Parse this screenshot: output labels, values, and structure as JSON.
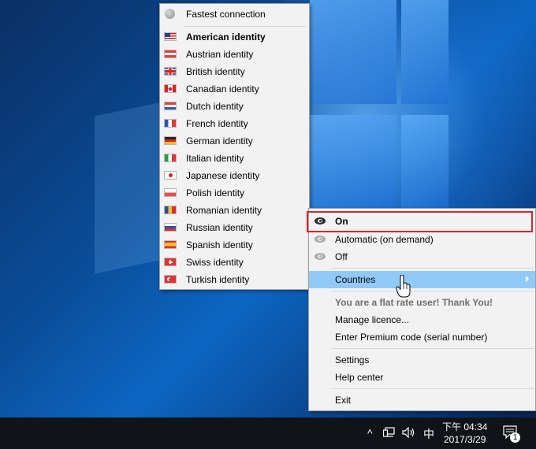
{
  "identity_menu": {
    "fastest": "Fastest connection",
    "items": [
      {
        "label": "American identity",
        "flag": "us-flag"
      },
      {
        "label": "Austrian identity",
        "flag": "at-flag"
      },
      {
        "label": "British identity",
        "flag": "gb-flag"
      },
      {
        "label": "Canadian identity",
        "flag": "ca-flag"
      },
      {
        "label": "Dutch identity",
        "flag": "nl-flag"
      },
      {
        "label": "French identity",
        "flag": "fr-flag"
      },
      {
        "label": "German identity",
        "flag": "de-flag"
      },
      {
        "label": "Italian identity",
        "flag": "it-flag"
      },
      {
        "label": "Japanese identity",
        "flag": "jp-flag"
      },
      {
        "label": "Polish identity",
        "flag": "pl-flag"
      },
      {
        "label": "Romanian identity",
        "flag": "ro-flag"
      },
      {
        "label": "Russian identity",
        "flag": "ru-flag"
      },
      {
        "label": "Spanish identity",
        "flag": "es-flag"
      },
      {
        "label": "Swiss identity",
        "flag": "ch-flag"
      },
      {
        "label": "Turkish identity",
        "flag": "tr-flag"
      }
    ]
  },
  "main_menu": {
    "on": "On",
    "automatic": "Automatic (on demand)",
    "off": "Off",
    "countries": "Countries",
    "flat_rate": "You are a flat rate user! Thank You!",
    "manage_licence": "Manage licence...",
    "premium_code": "Enter Premium code (serial number)",
    "settings": "Settings",
    "help_center": "Help center",
    "exit": "Exit"
  },
  "taskbar": {
    "chevron": "^",
    "ime": "中",
    "time": "下午 04:34",
    "date": "2017/3/29",
    "notification_count": "1"
  },
  "colors": {
    "highlight": "#91c9f7",
    "accent_box": "#d9262c"
  }
}
